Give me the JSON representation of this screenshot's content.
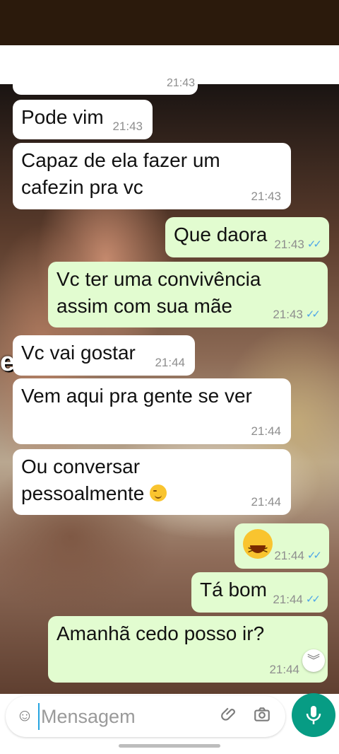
{
  "background": {
    "caption": "ecc"
  },
  "messages": [
    {
      "direction": "in",
      "text": "21:43",
      "time": ""
    },
    {
      "direction": "in",
      "text": "Pode vim",
      "time": "21:43"
    },
    {
      "direction": "in",
      "lines": [
        "Capaz de ela fazer um",
        "cafezin pra vc"
      ],
      "time": "21:43"
    },
    {
      "direction": "out",
      "text": "Que daora",
      "time": "21:43",
      "status": "read"
    },
    {
      "direction": "out",
      "lines": [
        "Vc ter uma convivência",
        "assim com sua mãe"
      ],
      "time": "21:43",
      "status": "read"
    },
    {
      "direction": "in",
      "text": "Vc vai gostar",
      "time": "21:44"
    },
    {
      "direction": "in",
      "text": "Vem aqui pra gente se ver",
      "time": "21:44"
    },
    {
      "direction": "in",
      "lines": [
        "Ou conversar",
        "pessoalmente"
      ],
      "emoji": "smirking-face",
      "time": "21:44"
    },
    {
      "direction": "out",
      "emoji": "laughing-face",
      "time": "21:44",
      "status": "read"
    },
    {
      "direction": "out",
      "text": "Tá bom",
      "time": "21:44",
      "status": "read"
    },
    {
      "direction": "out",
      "text": "Amanhã cedo posso ir?",
      "time": "21:44",
      "status": "sent"
    }
  ],
  "composer": {
    "placeholder": "Mensagem"
  },
  "colors": {
    "incoming": "#ffffff",
    "outgoing": "#e2fcd0",
    "read_ticks": "#4ea6e8",
    "mic": "#079c84"
  }
}
